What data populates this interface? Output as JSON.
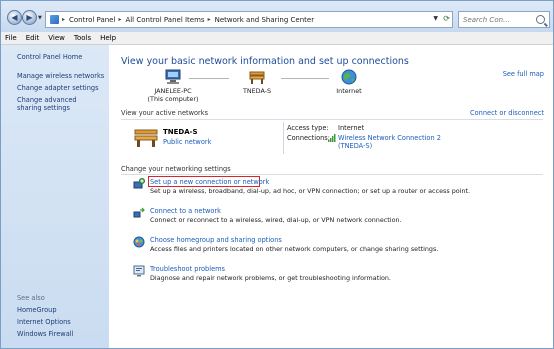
{
  "address_bar": {
    "crumbs": [
      "Control Panel",
      "All Control Panel Items",
      "Network and Sharing Center"
    ],
    "search_placeholder": "Search Con..."
  },
  "menu": [
    "File",
    "Edit",
    "View",
    "Tools",
    "Help"
  ],
  "sidebar": {
    "home": "Control Panel Home",
    "items": [
      "Manage wireless networks",
      "Change adapter settings",
      "Change advanced sharing settings"
    ],
    "see_also_label": "See also",
    "see_also": [
      "HomeGroup",
      "Internet Options",
      "Windows Firewall"
    ]
  },
  "main": {
    "title": "View your basic network information and set up connections",
    "see_full_map": "See full map",
    "map": {
      "computer": "JANELEE-PC",
      "computer_sub": "(This computer)",
      "network": "TNEDA-S",
      "internet": "Internet"
    },
    "active_header": "View your active networks",
    "connect_or_disconnect": "Connect or disconnect",
    "active_network": {
      "name": "TNEDA-S",
      "type": "Public network",
      "access_type_label": "Access type:",
      "access_type_value": "Internet",
      "connections_label": "Connections:",
      "connections_value_line1": "Wireless Network Connection 2",
      "connections_value_line2": "(TNEDA-S)"
    },
    "change_header": "Change your networking settings",
    "tasks": [
      {
        "title": "Set up a new connection or network",
        "desc": "Set up a wireless, broadband, dial-up, ad hoc, or VPN connection; or set up a router or access point."
      },
      {
        "title": "Connect to a network",
        "desc": "Connect or reconnect to a wireless, wired, dial-up, or VPN network connection."
      },
      {
        "title": "Choose homegroup and sharing options",
        "desc": "Access files and printers located on other network computers, or change sharing settings."
      },
      {
        "title": "Troubleshoot problems",
        "desc": "Diagnose and repair network problems, or get troubleshooting information."
      }
    ]
  },
  "colors": {
    "link": "#1c5dbb",
    "title": "#1e4c9a",
    "highlight": "#d9262b"
  }
}
